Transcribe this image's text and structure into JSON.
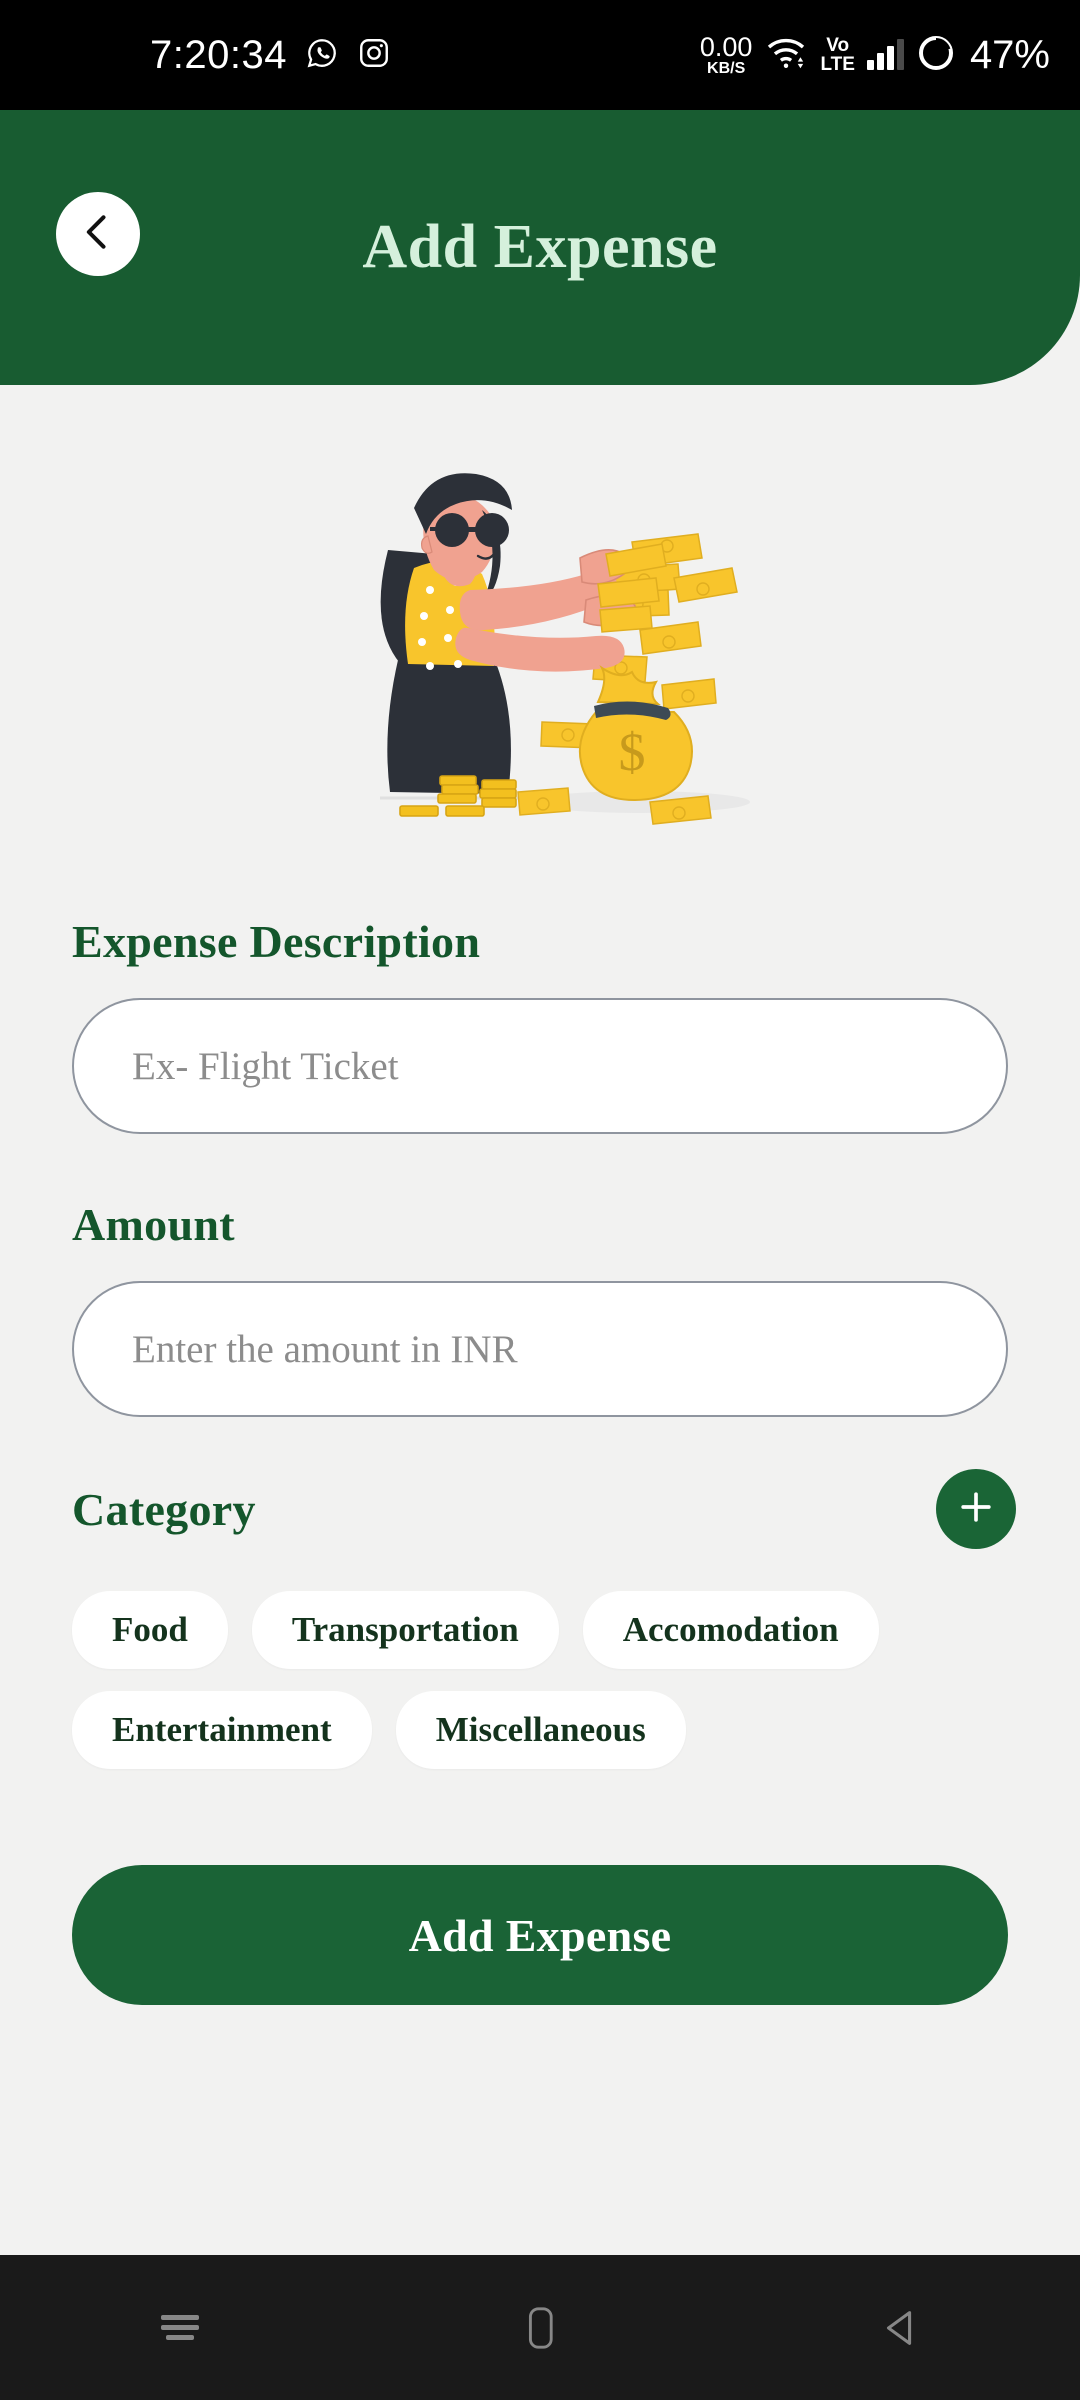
{
  "statusbar": {
    "time": "7:20:34",
    "apps": [
      {
        "name": "whatsapp-icon"
      },
      {
        "name": "instagram-icon"
      }
    ],
    "network_speed_value": "0.00",
    "network_speed_unit": "KB/S",
    "wifi_icon": "wifi-icon",
    "volte_top": "Vo",
    "volte_bottom": "LTE",
    "signal_icon": "signal-bars-icon",
    "battery_icon": "battery-circle-icon",
    "battery_percent": "47%"
  },
  "header": {
    "title": "Add Expense",
    "back_icon": "chevron-left-icon",
    "bg_color": "#185c31",
    "title_color": "#d5f0dc"
  },
  "illustration": {
    "alt": "woman-throwing-money-illustration",
    "money_bag_symbol": "$",
    "colors": {
      "money_yellow": "#f8c52c",
      "skin": "#f0a290",
      "dark": "#2c3038",
      "shadow": "#e3e3e3"
    }
  },
  "form": {
    "description": {
      "label": "Expense Description",
      "placeholder": "Ex- Flight Ticket",
      "value": ""
    },
    "amount": {
      "label": "Amount",
      "placeholder": "Enter the amount in INR",
      "value": ""
    },
    "category": {
      "label": "Category",
      "add_icon": "plus-icon",
      "chips": [
        {
          "label": "Food"
        },
        {
          "label": "Transportation"
        },
        {
          "label": "Accomodation"
        },
        {
          "label": "Entertainment"
        },
        {
          "label": "Miscellaneous"
        }
      ]
    },
    "submit_label": "Add Expense",
    "accent_color": "#1a6336",
    "label_color": "#14562c",
    "page_bg": "#f2f2f1"
  },
  "navbar": {
    "recents_icon": "recents-menu-icon",
    "home_icon": "home-square-icon",
    "back_icon": "back-triangle-icon"
  }
}
